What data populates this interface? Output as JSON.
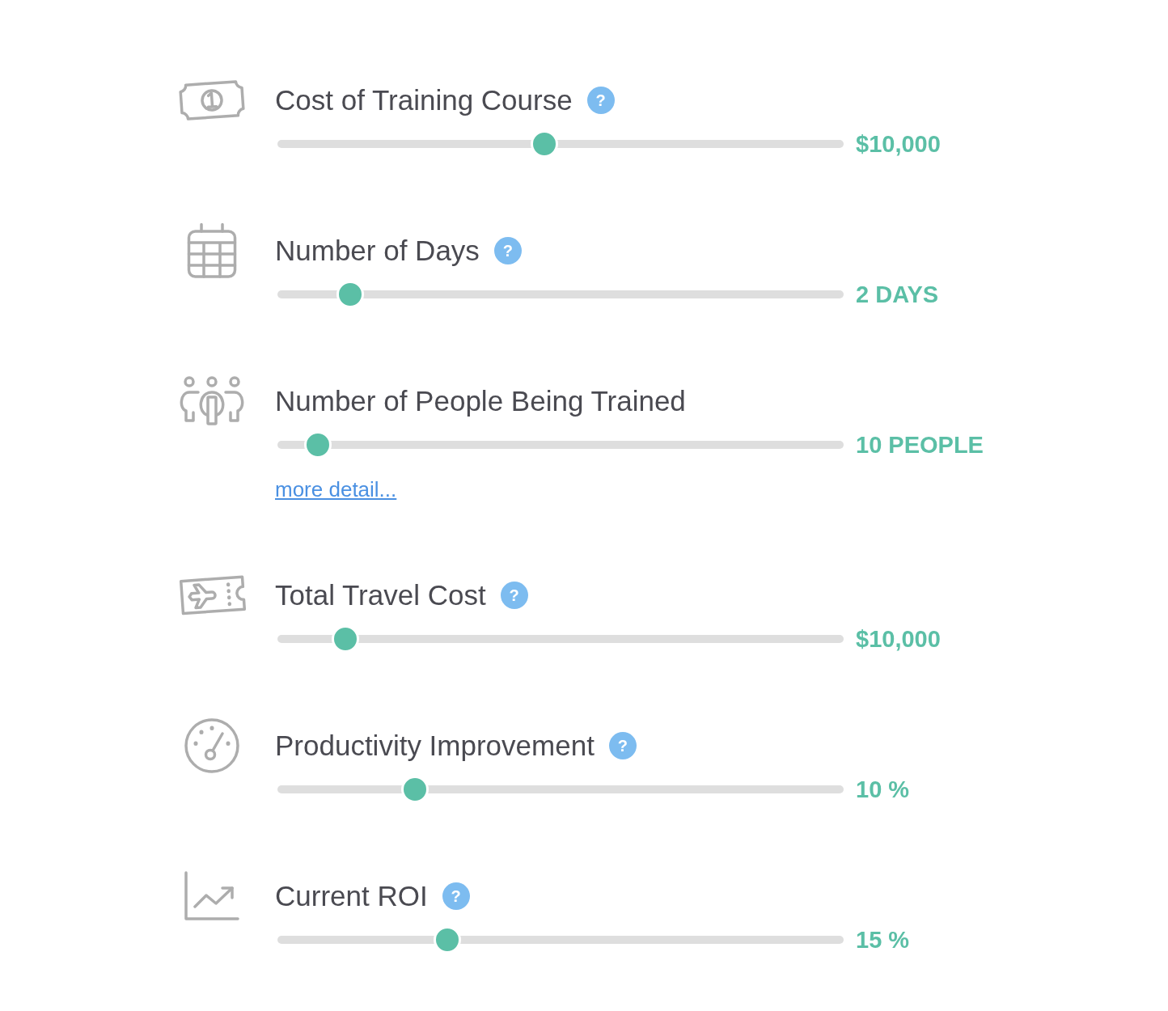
{
  "rows": [
    {
      "title": "Cost of Training Course",
      "help": "?",
      "level": 0.47,
      "value": "$10,000"
    },
    {
      "title": "Number of Days",
      "help": "?",
      "level": 0.11,
      "value": "2 DAYS"
    },
    {
      "title": "Number of People Being Trained",
      "level": 0.05,
      "value": "10 PEOPLE",
      "link": "more detail..."
    },
    {
      "title": "Total Travel Cost",
      "help": "?",
      "level": 0.1,
      "value": "$10,000"
    },
    {
      "title": "Productivity Improvement",
      "help": "?",
      "level": 0.23,
      "value": "10 %"
    },
    {
      "title": "Current ROI",
      "help": "?",
      "level": 0.29,
      "value": "15 %"
    }
  ]
}
